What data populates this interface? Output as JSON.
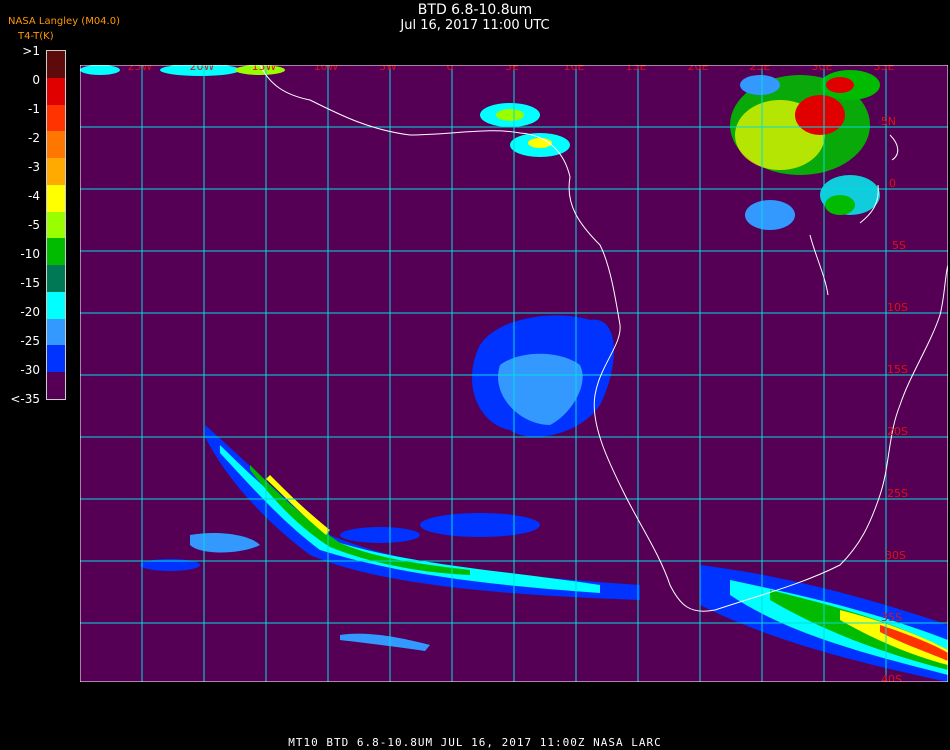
{
  "header": {
    "title": "BTD 6.8-10.8um",
    "subtitle": "Jul 16, 2017 11:00 UTC",
    "credit": "NASA Langley (M04.0)",
    "units": "T4-T(K)"
  },
  "colorbar": {
    "labels": [
      ">1",
      "0",
      "-1",
      "-2",
      "-3",
      "-4",
      "-5",
      "-10",
      "-15",
      "-20",
      "-25",
      "-30",
      "<-35"
    ],
    "colors": [
      "#5c0a0a",
      "#e00000",
      "#ff3300",
      "#ff7700",
      "#ffaa00",
      "#ffff00",
      "#99ff00",
      "#00bb00",
      "#007755",
      "#00ffff",
      "#3399ff",
      "#0033ff",
      "#550055"
    ]
  },
  "map": {
    "background_color": "#550055",
    "grid_color": "#00dddd",
    "coastline_color": "#ffffff",
    "lon_labels": [
      "25W",
      "20W",
      "15W",
      "10W",
      "5W",
      "0",
      "5E",
      "10E",
      "15E",
      "20E",
      "25E",
      "30E",
      "35E"
    ],
    "lat_labels": [
      "5N",
      "0",
      "5S",
      "10S",
      "15S",
      "20S",
      "25S",
      "30S",
      "35S",
      "40S"
    ]
  },
  "footer": {
    "text": "MT10   BTD 6.8-10.8UM    JUL 16, 2017 11:00Z    NASA LARC"
  }
}
